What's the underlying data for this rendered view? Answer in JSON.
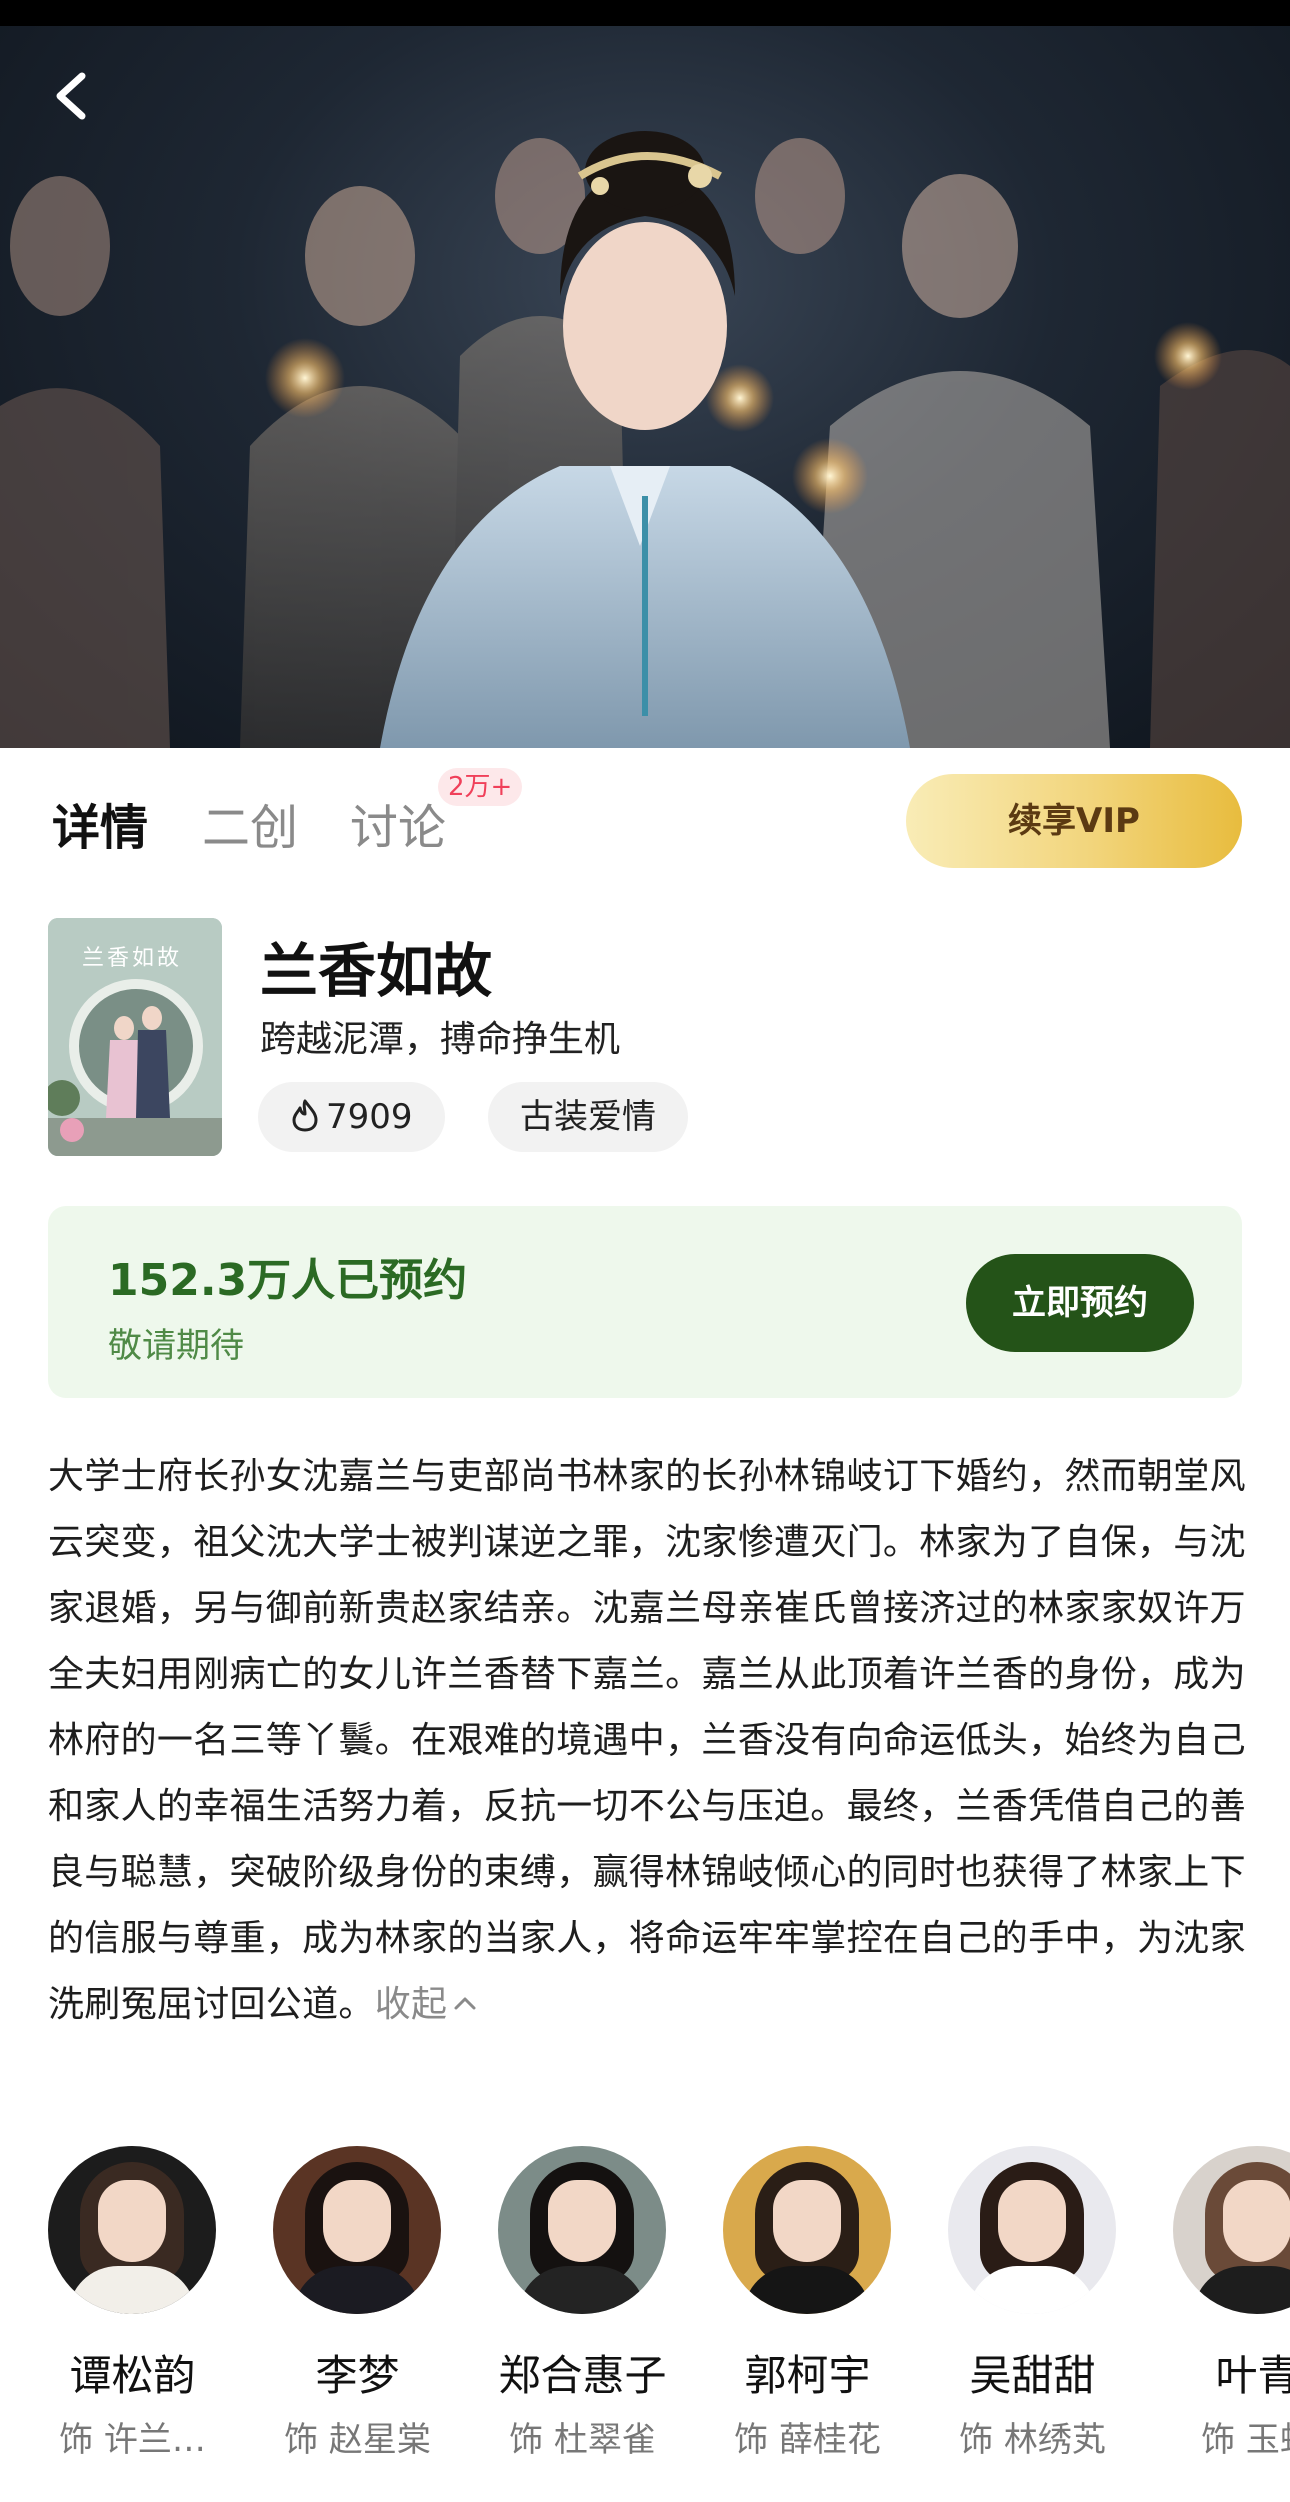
{
  "tabs": [
    {
      "label": "详情",
      "active": true
    },
    {
      "label": "二创",
      "active": false
    },
    {
      "label": "讨论",
      "active": false,
      "badge": "2万+"
    }
  ],
  "vip_button": "续享VIP",
  "show": {
    "poster_title": "兰香如故",
    "title": "兰香如故",
    "subtitle": "跨越泥潭，搏命挣生机",
    "heat": "7909",
    "genre": "古装爱情"
  },
  "reserve": {
    "count_text": "152.3万人已预约",
    "note": "敬请期待",
    "button": "立即预约"
  },
  "description": "大学士府长孙女沈嘉兰与吏部尚书林家的长孙林锦岐订下婚约，然而朝堂风云突变，祖父沈大学士被判谋逆之罪，沈家惨遭灭门。林家为了自保，与沈家退婚，另与御前新贵赵家结亲。沈嘉兰母亲崔氏曾接济过的林家家奴许万全夫妇用刚病亡的女儿许兰香替下嘉兰。嘉兰从此顶着许兰香的身份，成为林府的一名三等丫鬟。在艰难的境遇中，兰香没有向命运低头，始终为自己和家人的幸福生活努力着，反抗一切不公与压迫。最终，兰香凭借自己的善良与聪慧，突破阶级身份的束缚，赢得林锦岐倾心的同时也获得了林家上下的信服与尊重，成为林家的当家人，将命运牢牢掌控在自己的手中，为沈家洗刷冤屈讨回公道。",
  "collapse_label": "收起",
  "cast": [
    {
      "name": "谭松韵",
      "role": "饰 许兰…"
    },
    {
      "name": "李梦",
      "role": "饰 赵星棠"
    },
    {
      "name": "郑合惠子",
      "role": "饰 杜翠雀"
    },
    {
      "name": "郭柯宇",
      "role": "饰 薛桂花"
    },
    {
      "name": "吴甜甜",
      "role": "饰 林绣芄"
    },
    {
      "name": "叶青",
      "role": "饰 玉蚌"
    }
  ],
  "colors": {
    "reserve_bg": "#eef8ec",
    "reserve_text": "#2b6a24",
    "reserve_button": "#245318",
    "vip_gold": "#e8bc3e",
    "badge_red": "#f0405a"
  }
}
